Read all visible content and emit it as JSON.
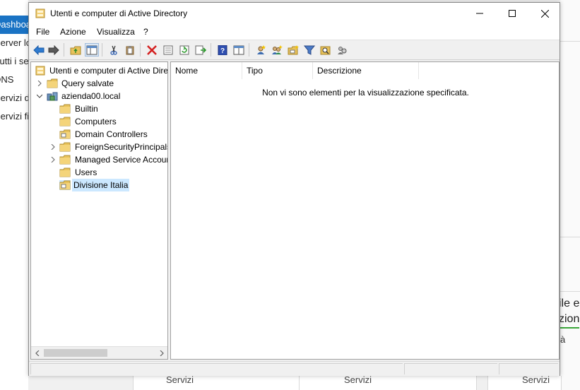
{
  "background": {
    "nav_items": [
      {
        "label": "Dashboard",
        "active": true
      },
      {
        "label": "Server locale",
        "active": false
      },
      {
        "label": "Tutti i server",
        "active": false
      },
      {
        "label": "DNS",
        "active": false
      },
      {
        "label": "Servizi di dominio Active Directory",
        "active": false
      },
      {
        "label": "Servizi file e archiviazione",
        "active": false
      }
    ],
    "right_text_1": "ile e",
    "right_text_2": "zion",
    "right_small": "à",
    "bottom_tiles": [
      "Servizi",
      "Servizi",
      "Servizi"
    ]
  },
  "window": {
    "title": "Utenti e computer di Active Directory",
    "menu": [
      "File",
      "Azione",
      "Visualizza",
      "?"
    ],
    "toolbar_icons": [
      "back-icon",
      "forward-icon",
      "up-folder-icon",
      "show-hide-console-tree-icon",
      "cut-icon",
      "paste-icon",
      "delete-icon",
      "properties-icon",
      "refresh-icon",
      "export-list-icon",
      "help-icon",
      "view-icon",
      "new-user-icon",
      "new-group-icon",
      "new-ou-icon",
      "filter-icon",
      "find-icon",
      "delegate-icon"
    ],
    "tree": {
      "root": "Utenti e computer di Active Directory",
      "items": [
        {
          "label": "Query salvate",
          "level": 1,
          "expander": "collapsed",
          "icon": "folder-icon"
        },
        {
          "label": "azienda00.local",
          "level": 1,
          "expander": "expanded",
          "icon": "domain-icon"
        },
        {
          "label": "Builtin",
          "level": 2,
          "expander": "none",
          "icon": "folder-icon"
        },
        {
          "label": "Computers",
          "level": 2,
          "expander": "none",
          "icon": "folder-icon"
        },
        {
          "label": "Domain Controllers",
          "level": 2,
          "expander": "none",
          "icon": "ou-icon"
        },
        {
          "label": "ForeignSecurityPrincipals",
          "level": 2,
          "expander": "collapsed",
          "icon": "folder-icon"
        },
        {
          "label": "Managed Service Accounts",
          "level": 2,
          "expander": "collapsed",
          "icon": "folder-icon"
        },
        {
          "label": "Users",
          "level": 2,
          "expander": "none",
          "icon": "folder-icon"
        },
        {
          "label": "Divisione Italia",
          "level": 2,
          "expander": "none",
          "icon": "ou-icon",
          "selected": true
        }
      ]
    },
    "columns": [
      "Nome",
      "Tipo",
      "Descrizione"
    ],
    "empty_message": "Non vi sono elementi per la visualizzazione specificata."
  },
  "colors": {
    "accent": "#1a73c4",
    "selection": "#cce8ff",
    "folder": "#e8c25a"
  }
}
